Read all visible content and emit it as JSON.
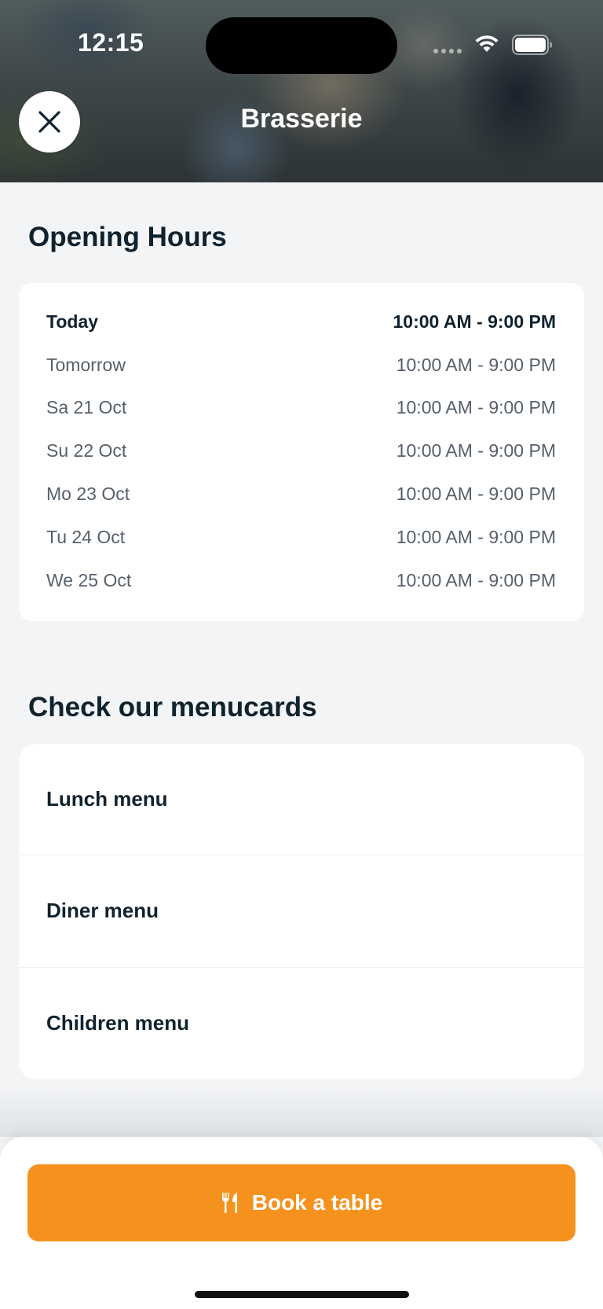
{
  "status_bar": {
    "time": "12:15",
    "icons": [
      "cellular-dots-icon",
      "wifi-icon",
      "battery-icon"
    ]
  },
  "header": {
    "title": "Brasserie",
    "close_icon": "close-icon"
  },
  "opening_hours": {
    "title": "Opening Hours",
    "rows": [
      {
        "day": "Today",
        "hours": "10:00 AM - 9:00 PM",
        "highlighted": true
      },
      {
        "day": "Tomorrow",
        "hours": "10:00 AM - 9:00 PM"
      },
      {
        "day": "Sa 21 Oct",
        "hours": "10:00 AM - 9:00 PM"
      },
      {
        "day": "Su 22 Oct",
        "hours": "10:00 AM - 9:00 PM"
      },
      {
        "day": "Mo 23 Oct",
        "hours": "10:00 AM - 9:00 PM"
      },
      {
        "day": "Tu 24 Oct",
        "hours": "10:00 AM - 9:00 PM"
      },
      {
        "day": "We 25 Oct",
        "hours": "10:00 AM - 9:00 PM"
      }
    ]
  },
  "menus": {
    "title": "Check our menucards",
    "items": [
      {
        "label": "Lunch menu"
      },
      {
        "label": "Diner menu"
      },
      {
        "label": "Children menu"
      }
    ]
  },
  "cta": {
    "label": "Book a table",
    "icon": "fork-knife-icon"
  },
  "colors": {
    "accent": "#f5921e",
    "text_dark": "#10222e",
    "text_muted": "#56606a",
    "background": "#f2f4f6"
  }
}
